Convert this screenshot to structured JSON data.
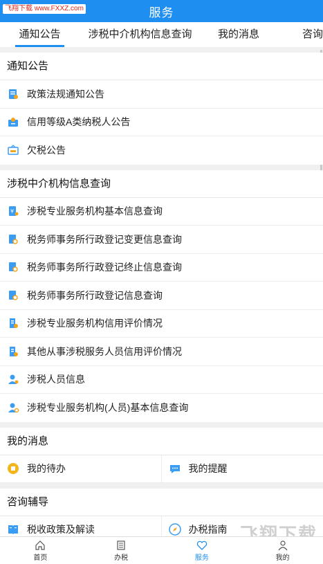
{
  "header": {
    "title": "服务",
    "watermark": "飞翔下载 www.FXXZ.com"
  },
  "tabs": [
    {
      "label": "通知公告",
      "active": true
    },
    {
      "label": "涉税中介机构信息查询",
      "active": false
    },
    {
      "label": "我的消息",
      "active": false
    },
    {
      "label": "咨询",
      "active": false
    }
  ],
  "notices": {
    "title": "通知公告",
    "items": [
      {
        "label": "政策法规通知公告",
        "icon": "document-icon"
      },
      {
        "label": "信用等级A类纳税人公告",
        "icon": "person-badge-icon"
      },
      {
        "label": "欠税公告",
        "icon": "sign-board-icon"
      }
    ]
  },
  "agency": {
    "title": "涉税中介机构信息查询",
    "items": [
      {
        "label": "涉税专业服务机构基本信息查询"
      },
      {
        "label": "税务师事务所行政登记变更信息查询"
      },
      {
        "label": "税务师事务所行政登记终止信息查询"
      },
      {
        "label": "税务师事务所行政登记信息查询"
      },
      {
        "label": "涉税专业服务机构信用评价情况"
      },
      {
        "label": "其他从事涉税服务人员信用评价情况"
      },
      {
        "label": "涉税人员信息"
      },
      {
        "label": "涉税专业服务机构(人员)基本信息查询"
      }
    ]
  },
  "messages": {
    "title": "我的消息",
    "items": [
      {
        "label": "我的待办"
      },
      {
        "label": "我的提醒"
      }
    ]
  },
  "consult": {
    "title": "咨询辅导",
    "items": [
      {
        "label": "税收政策及解读"
      },
      {
        "label": "办税指南"
      }
    ]
  },
  "bottom_nav": [
    {
      "label": "首页",
      "active": false
    },
    {
      "label": "办税",
      "active": false
    },
    {
      "label": "服务",
      "active": true
    },
    {
      "label": "我的",
      "active": false
    }
  ],
  "watermark_bottom": "飞翔下载",
  "colors": {
    "accent": "#1e8ff0",
    "icon_blue": "#3a9cf2",
    "icon_orange": "#f2a51c"
  }
}
